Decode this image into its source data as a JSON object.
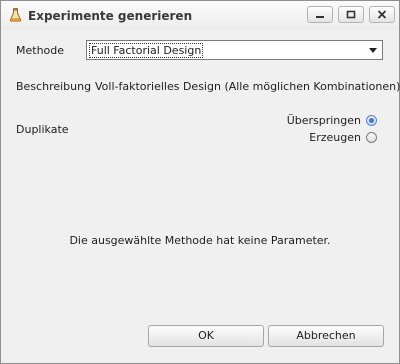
{
  "window": {
    "title": "Experimente generieren",
    "icons": {
      "app": "flask-icon",
      "minimize": "minimize-icon",
      "maximize": "maximize-icon",
      "close": "close-icon"
    }
  },
  "form": {
    "method_label": "Methode",
    "method_value": "Full Factorial Design",
    "description_label": "Beschreibung",
    "description_text": "Voll-faktorielles Design (Alle möglichen Kombinationen)",
    "duplicates_label": "Duplikate",
    "duplicates_options": [
      {
        "label": "Überspringen",
        "checked": true
      },
      {
        "label": "Erzeugen",
        "checked": false
      }
    ],
    "no_params_message": "Die ausgewählte Methode hat keine Parameter."
  },
  "buttons": {
    "ok": "OK",
    "cancel": "Abbrechen"
  },
  "colors": {
    "radio_accent": "#4a77b8",
    "dialog_bg": "#f0f0f0"
  }
}
